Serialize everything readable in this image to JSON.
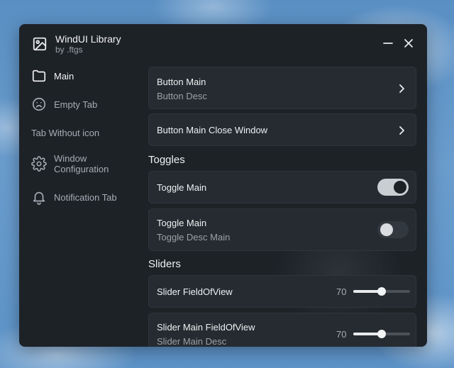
{
  "window": {
    "title": "WindUI Library",
    "subtitle": "by .ftgs"
  },
  "sidebar": {
    "items": [
      {
        "label": "Main",
        "icon": "folder-icon",
        "active": true
      },
      {
        "label": "Empty Tab",
        "icon": "frown-face-icon"
      },
      {
        "label": "Tab Without icon"
      },
      {
        "label": "Window Configuration",
        "icon": "gear-icon"
      },
      {
        "label": "Notification Tab",
        "icon": "bell-icon"
      }
    ]
  },
  "main": {
    "buttons": [
      {
        "title": "Button Main",
        "desc": "Button Desc"
      },
      {
        "title": "Button Main Close Window"
      }
    ],
    "toggles_header": "Toggles",
    "toggles": [
      {
        "title": "Toggle Main",
        "value": true
      },
      {
        "title": "Toggle Main",
        "desc": "Toggle Desc Main",
        "value": false
      }
    ],
    "sliders_header": "Sliders",
    "sliders": [
      {
        "title": "Slider FieldOfView",
        "value": "70",
        "fraction": 0.5
      },
      {
        "title": "Slider Main FieldOfView",
        "desc": "Slider Main Desc",
        "value": "70",
        "fraction": 0.5
      }
    ]
  },
  "colors": {
    "window_bg": "#1d2227",
    "card_bg": "#262b31",
    "text": "#eef0f2",
    "muted": "#9aa1a8"
  }
}
